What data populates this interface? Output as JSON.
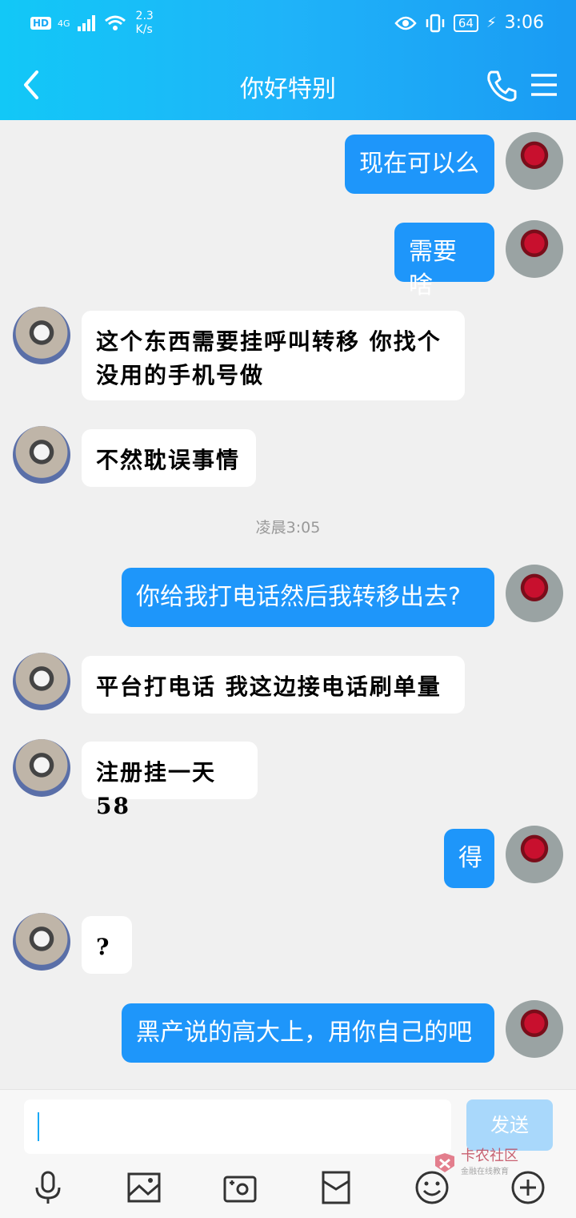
{
  "status_bar": {
    "hd": "HD",
    "network": "4G",
    "speed_value": "2.3",
    "speed_unit": "K/s",
    "battery": "64",
    "time": "3:06"
  },
  "header": {
    "title": "你好特别"
  },
  "messages": [
    {
      "side": "out",
      "text": "现在可以么"
    },
    {
      "side": "out",
      "text": "需要啥"
    },
    {
      "side": "in",
      "text": "这个东西需要挂呼叫转移 你找个没用的手机号做"
    },
    {
      "side": "in",
      "text": "不然耽误事情"
    },
    {
      "side": "out",
      "text": "你给我打电话然后我转移出去?"
    },
    {
      "side": "in",
      "text": "平台打电话 我这边接电话刷单量"
    },
    {
      "side": "in",
      "text": "注册挂一天58"
    },
    {
      "side": "out",
      "text": "得"
    },
    {
      "side": "in",
      "text": "?"
    },
    {
      "side": "out",
      "text": "黑产说的高大上，用你自己的吧"
    }
  ],
  "time_label": "凌晨3:05",
  "input": {
    "value": "",
    "send_label": "发送"
  },
  "toolbar": [
    "microphone-icon",
    "image-icon",
    "camera-icon",
    "red-packet-icon",
    "emoji-icon",
    "plus-icon"
  ],
  "watermark": {
    "text": "卡农社区",
    "sub": "金融在线教育"
  }
}
